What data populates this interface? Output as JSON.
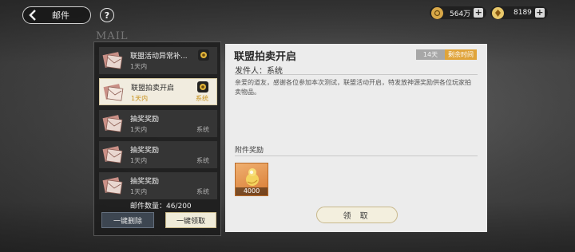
{
  "header": {
    "back_label": "邮件",
    "help_label": "?"
  },
  "resources": {
    "coins": "564万",
    "gems": "8189",
    "plus": "+"
  },
  "mailbox": {
    "watermark": "MAIL",
    "items": [
      {
        "title": "联盟活动异常补...",
        "time": "1天内",
        "sender": "",
        "selected": false,
        "has_badge": true
      },
      {
        "title": "联盟拍卖开启",
        "time": "1天内",
        "sender": "系统",
        "selected": true,
        "has_badge": true
      },
      {
        "title": "抽奖奖励",
        "time": "1天内",
        "sender": "系统",
        "selected": false,
        "has_badge": false
      },
      {
        "title": "抽奖奖励",
        "time": "1天内",
        "sender": "系统",
        "selected": false,
        "has_badge": false
      },
      {
        "title": "抽奖奖励",
        "time": "1天内",
        "sender": "系统",
        "selected": false,
        "has_badge": false
      }
    ],
    "count_label": "邮件数量：46/200",
    "delete_all": "一键删除",
    "claim_all": "一键领取"
  },
  "detail": {
    "title": "联盟拍卖开启",
    "days": "14天",
    "remaining": "剩余时间",
    "sender": "发件人：系统",
    "body": "亲爱的道友，感谢各位参加本次测试，联盟活动开启，特发放神源奖励供各位玩家拍卖物品。",
    "attachment_label": "附件奖励",
    "reward_amount": "4000",
    "receive_button": "领 取"
  },
  "colors": {
    "accent_gold": "#e0a43a",
    "selected_meta": "#c8921c",
    "panel_dark": "#1c1c1c",
    "detail_bg": "#ececec"
  }
}
